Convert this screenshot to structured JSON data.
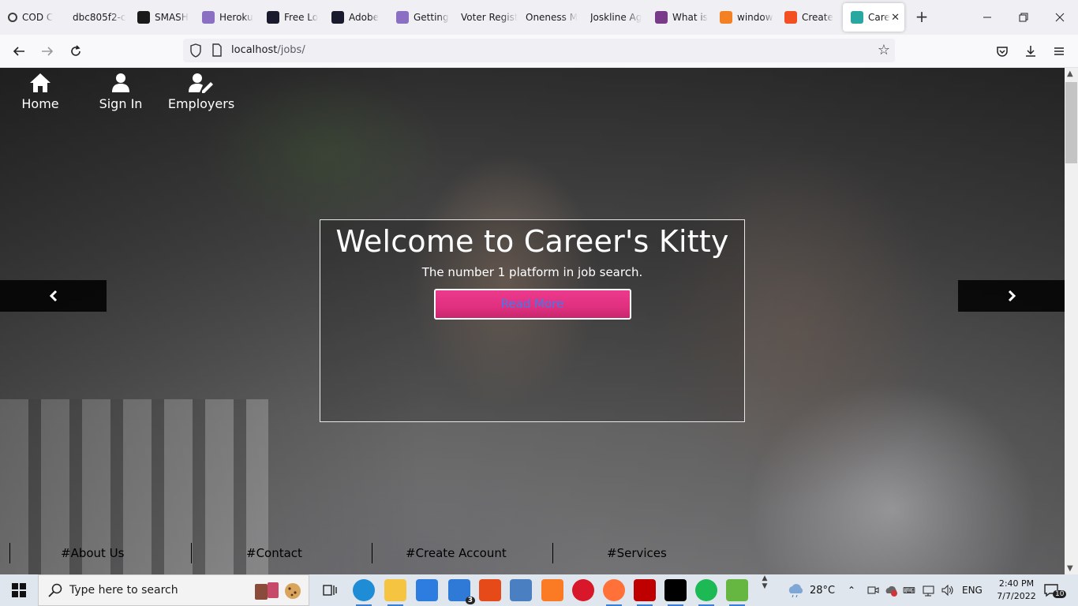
{
  "browser": {
    "tabs": [
      {
        "label": "COD C",
        "icon": "ring-icon",
        "color": "#3b3b3b"
      },
      {
        "label": "dbc805f2-c",
        "icon": "none",
        "color": "#ffffff"
      },
      {
        "label": "SMASH",
        "icon": "smash-icon",
        "color": "#1a1a1a"
      },
      {
        "label": "Heroku",
        "icon": "heroku-icon",
        "color": "#8a6fc2"
      },
      {
        "label": "Free Lo",
        "icon": "free-logo-icon",
        "color": "#1a1a2e"
      },
      {
        "label": "Adobe",
        "icon": "adobe-icon",
        "color": "#1a1a2e"
      },
      {
        "label": "Getting",
        "icon": "heroku-icon",
        "color": "#8a6fc2"
      },
      {
        "label": "Voter Regist",
        "icon": "none",
        "color": "#ffffff"
      },
      {
        "label": "Oneness M",
        "icon": "none",
        "color": "#ffffff"
      },
      {
        "label": "Joskline Ag",
        "icon": "none",
        "color": "#ffffff"
      },
      {
        "label": "What is",
        "icon": "link-icon",
        "color": "#7a3a8a"
      },
      {
        "label": "window",
        "icon": "stack-icon",
        "color": "#f48024"
      },
      {
        "label": "Create",
        "icon": "microsoft-icon",
        "color": "#f25022"
      },
      {
        "label": "Care",
        "icon": "career-kitty-icon",
        "color": "#2aa7a0",
        "active": true
      }
    ],
    "url_host": "localhost",
    "url_path": "/jobs/"
  },
  "site": {
    "nav": [
      {
        "label": "Home",
        "icon": "home-icon"
      },
      {
        "label": "Sign In",
        "icon": "user-icon"
      },
      {
        "label": "Employers",
        "icon": "user-edit-icon"
      }
    ],
    "hero": {
      "title": "Welcome to Career's Kitty",
      "subtitle": "The number 1 platform in job search.",
      "button": "Read More"
    },
    "footer_links": [
      "#About Us",
      "#Contact",
      "#Create Account",
      "#Services"
    ]
  },
  "taskbar": {
    "search_placeholder": "Type here to search",
    "weather": "28°C",
    "language": "ENG",
    "time": "2:40 PM",
    "date": "7/7/2022",
    "mail_badge": "3",
    "notification_badge": "10",
    "apps": [
      {
        "name": "task-view-icon",
        "color": "#222222"
      },
      {
        "name": "edge-icon",
        "color": "#1f8dd6"
      },
      {
        "name": "file-explorer-icon",
        "color": "#f5c441"
      },
      {
        "name": "store-icon",
        "color": "#2d7de0"
      },
      {
        "name": "mail-icon",
        "color": "#2f7ad6"
      },
      {
        "name": "office-icon",
        "color": "#e64a19"
      },
      {
        "name": "network-icon",
        "color": "#4a7fc1"
      },
      {
        "name": "xampp-icon",
        "color": "#fb7a24"
      },
      {
        "name": "opera-icon",
        "color": "#d8172a"
      },
      {
        "name": "firefox-icon",
        "color": "#ff7139"
      },
      {
        "name": "filezilla-icon",
        "color": "#bf0000"
      },
      {
        "name": "intellij-icon",
        "color": "#000000"
      },
      {
        "name": "spotify-icon",
        "color": "#1db954"
      },
      {
        "name": "utorrent-icon",
        "color": "#65b741"
      }
    ]
  }
}
